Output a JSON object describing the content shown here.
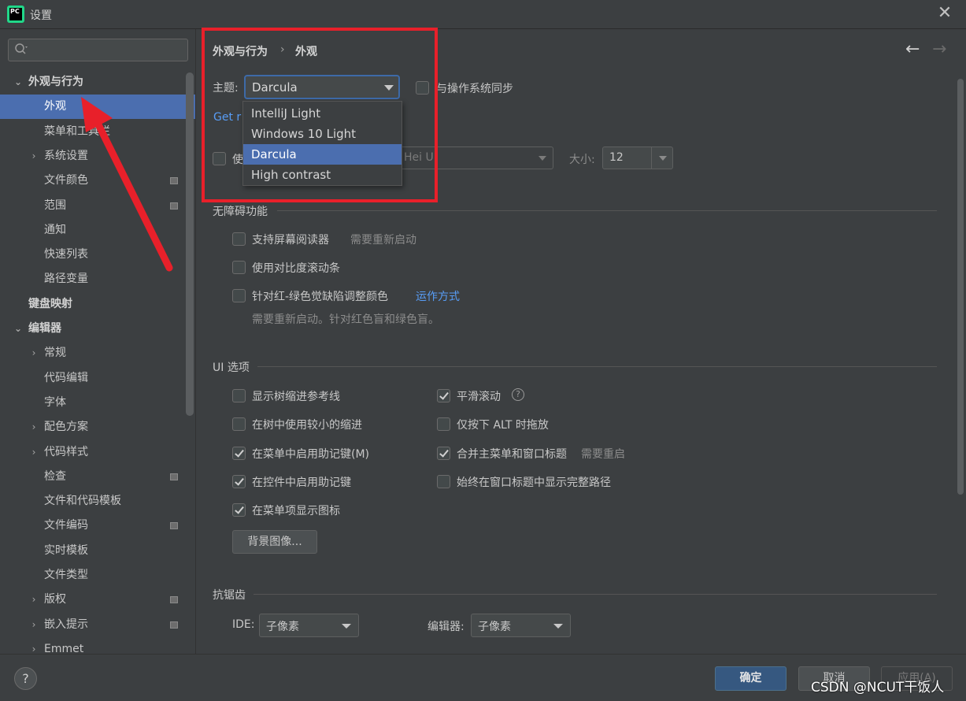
{
  "window": {
    "title": "设置",
    "app_icon_text": "PC"
  },
  "sidebar": {
    "search_placeholder": "",
    "items": [
      {
        "label": "外观与行为",
        "expanded": true
      },
      {
        "label": "外观",
        "selected": true
      },
      {
        "label": "菜单和工具栏"
      },
      {
        "label": "系统设置",
        "expandable": true
      },
      {
        "label": "文件颜色"
      },
      {
        "label": "范围"
      },
      {
        "label": "通知"
      },
      {
        "label": "快速列表"
      },
      {
        "label": "路径变量"
      },
      {
        "label": "键盘映射"
      },
      {
        "label": "编辑器",
        "expanded": true
      },
      {
        "label": "常规",
        "expandable": true
      },
      {
        "label": "代码编辑"
      },
      {
        "label": "字体"
      },
      {
        "label": "配色方案",
        "expandable": true
      },
      {
        "label": "代码样式",
        "expandable": true
      },
      {
        "label": "检查"
      },
      {
        "label": "文件和代码模板"
      },
      {
        "label": "文件编码"
      },
      {
        "label": "实时模板"
      },
      {
        "label": "文件类型"
      },
      {
        "label": "版权",
        "expandable": true
      },
      {
        "label": "嵌入提示",
        "expandable": true
      },
      {
        "label": "Emmet",
        "expandable": true
      }
    ]
  },
  "breadcrumb": {
    "parent": "外观与行为",
    "separator": "›",
    "current": "外观"
  },
  "theme": {
    "label": "主题:",
    "value": "Darcula",
    "sync_label": "与操作系统同步",
    "sync_checked": false,
    "options": [
      "IntelliJ Light",
      "Windows 10 Light",
      "Darcula",
      "High contrast"
    ],
    "selected_option": "Darcula"
  },
  "get_more_link": "Get r",
  "custom_font": {
    "checkbox_label": "使",
    "checked": false,
    "font_value": "Hei U",
    "size_label": "大小:",
    "size_value": "12"
  },
  "accessibility": {
    "title": "无障碍功能",
    "screen_reader": {
      "label": "支持屏幕阅读器",
      "hint": "需要重新启动",
      "checked": false
    },
    "contrast_scrollbar": {
      "label": "使用对比度滚动条",
      "checked": false
    },
    "color_deficiency": {
      "label": "针对红-绿色觉缺陷调整颜色",
      "link": "运作方式",
      "hint": "需要重新启动。针对红色盲和绿色盲。",
      "checked": false
    }
  },
  "ui_options": {
    "title": "UI 选项",
    "left": [
      {
        "label": "显示树缩进参考线",
        "checked": false
      },
      {
        "label": "在树中使用较小的缩进",
        "checked": false
      },
      {
        "label": "在菜单中启用助记键(M)",
        "checked": true
      },
      {
        "label": "在控件中启用助记键",
        "checked": true
      },
      {
        "label": "在菜单项显示图标",
        "checked": true
      }
    ],
    "right": [
      {
        "label": "平滑滚动",
        "checked": true,
        "help": "?"
      },
      {
        "label": "仅按下 ALT 时拖放",
        "checked": false
      },
      {
        "label": "合并主菜单和窗口标题",
        "checked": true,
        "hint": "需要重启"
      },
      {
        "label": "始终在窗口标题中显示完整路径",
        "checked": false
      }
    ],
    "background_button": "背景图像..."
  },
  "antialiasing": {
    "title": "抗锯齿",
    "ide_label": "IDE:",
    "ide_value": "子像素",
    "editor_label": "编辑器:",
    "editor_value": "子像素"
  },
  "footer": {
    "help": "?",
    "ok": "确定",
    "cancel": "取消",
    "apply": "应用(A)",
    "watermark": "CSDN @NCUT干饭人"
  },
  "colors": {
    "accent": "#4b6eaf",
    "annotation": "#e8202a",
    "link": "#589df6"
  }
}
